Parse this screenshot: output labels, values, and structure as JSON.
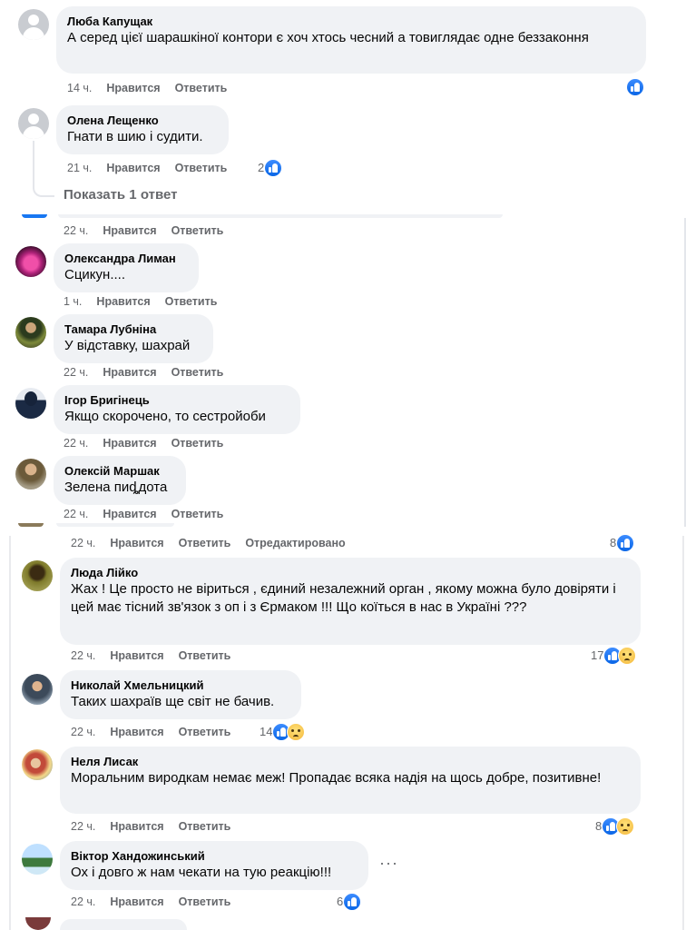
{
  "ui": {
    "likes": "Нравится",
    "reply": "Ответить",
    "edited": "Отредактировано",
    "show_reply": "Показать 1 ответ",
    "more": "···"
  },
  "comments": {
    "c1": {
      "name": "Люба Капущак",
      "text": "А серед цієї шарашкіної контори є хоч хтось чесний а товиглядає одне беззаконня",
      "time": "14 ч."
    },
    "c2": {
      "name": "Олена Лещенко",
      "text": "Гнати в шию і судити.",
      "time": "21 ч.",
      "count": "2"
    },
    "c3": {
      "time": "22 ч."
    },
    "c4": {
      "name": "Олександра Лиман",
      "text": "Сцикун....",
      "time": "1 ч."
    },
    "c5": {
      "name": "Тамара Лубніна",
      "text": "У відставку, шахрай",
      "time": "22 ч."
    },
    "c6": {
      "name": "Ігор Бригінець",
      "text": "Якщо скорочено, то сестройоби",
      "time": "22 ч."
    },
    "c7": {
      "name": "Олексій Маршак",
      "text": "Зелена пиȡдота",
      "time": "22 ч."
    },
    "c8": {
      "time": "22 ч.",
      "count": "8"
    },
    "c9": {
      "name": "Люда Лійко",
      "text": "Жах ! Це просто не віриться , єдиний незалежний орган , якому можна було довіряти і цей має тісний зв'язок з оп і з Єрмаком !!! Що коїться в нас в Україні ???",
      "time": "22 ч.",
      "count": "17"
    },
    "c10": {
      "name": "Николай Хмельницкий",
      "text": "Таких шахраїв ще світ не бачив.",
      "time": "22 ч.",
      "count": "14"
    },
    "c11": {
      "name": "Неля Лисак",
      "text": "Моральним виродкам немає меж! Пропадає всяка надія на щось добре, позитивне!",
      "time": "22 ч.",
      "count": "8"
    },
    "c12": {
      "name": "Віктор Хандожинський",
      "text": "Ох і довго ж нам чекати на тую реакцію!!!",
      "time": "22 ч.",
      "count": "6"
    }
  }
}
